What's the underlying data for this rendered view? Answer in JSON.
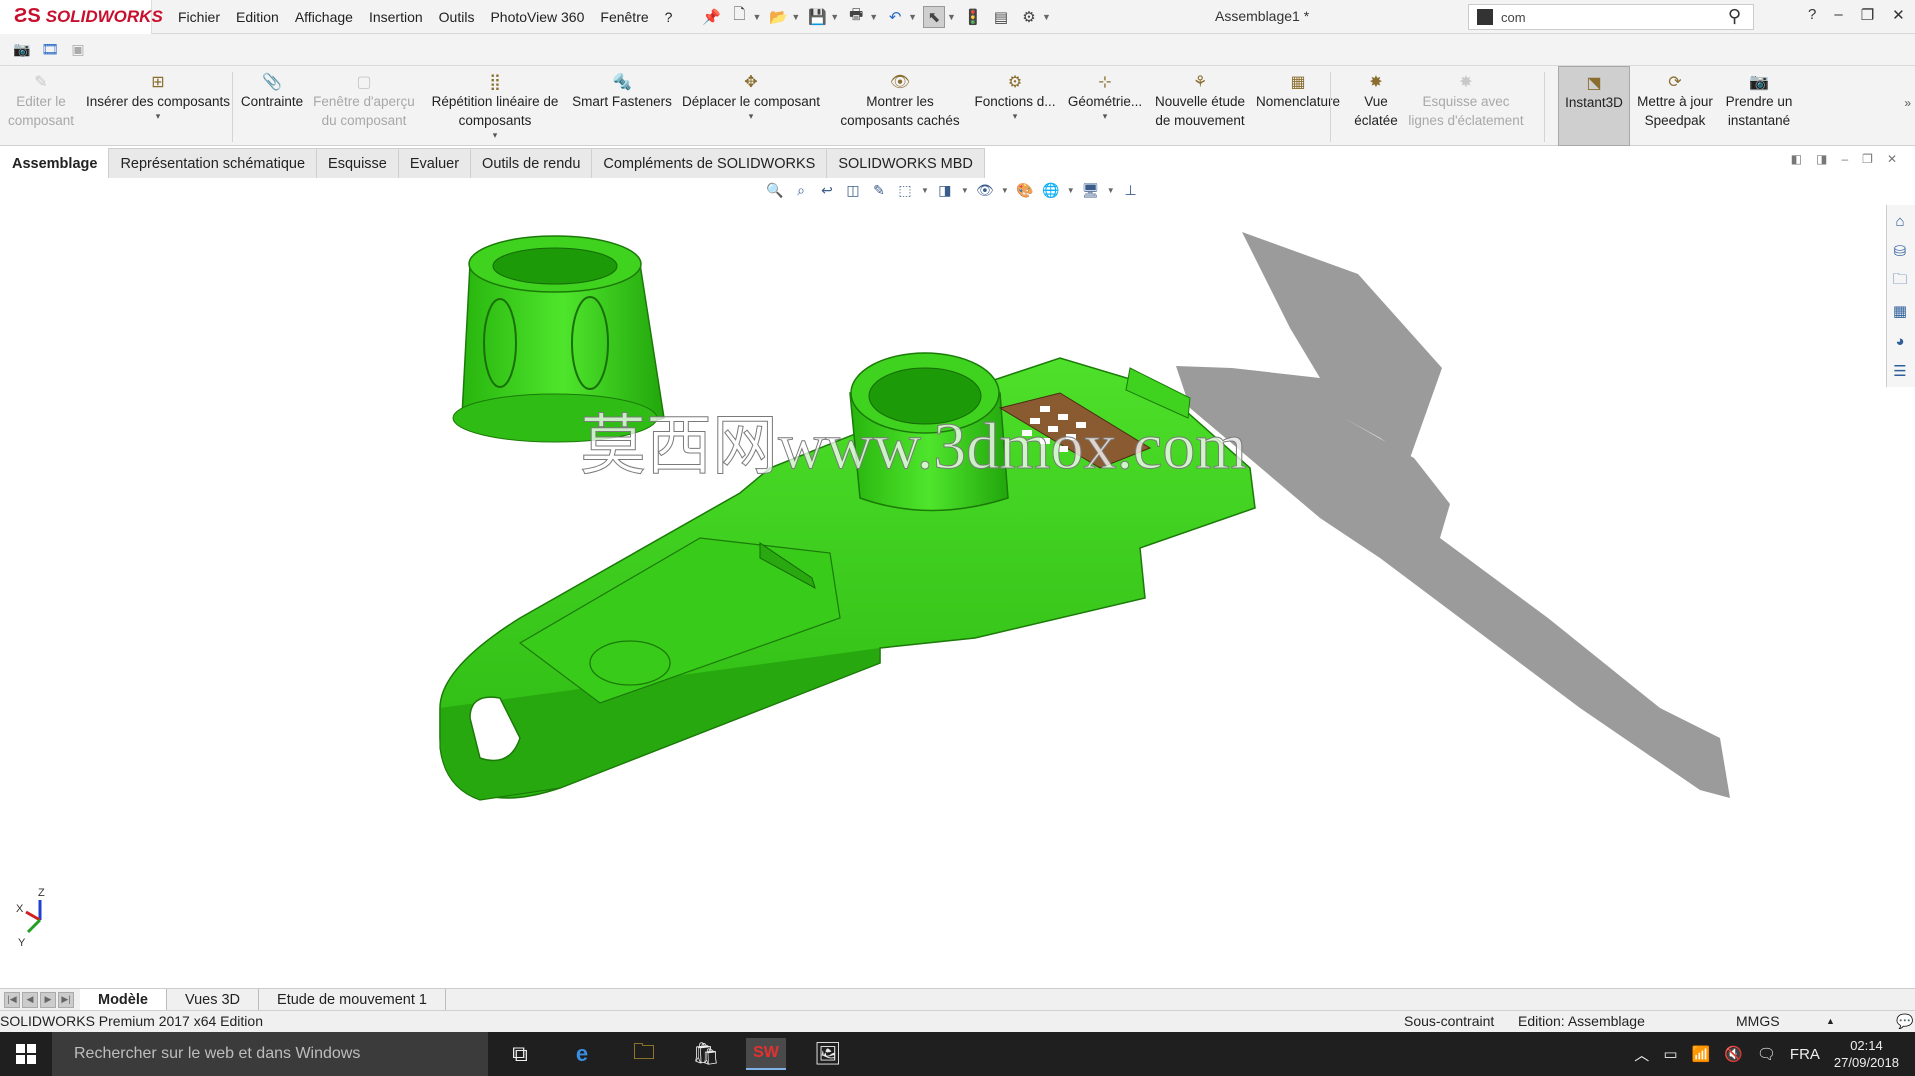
{
  "app": {
    "brand": "SOLIDWORKS",
    "document_title": "Assemblage1 *",
    "menu": [
      "Fichier",
      "Edition",
      "Affichage",
      "Insertion",
      "Outils",
      "PhotoView 360",
      "Fenêtre",
      "?"
    ],
    "search_value": "com"
  },
  "command_manager": [
    {
      "label": "Editer le composant",
      "icon": "edit-component-icon",
      "disabled": true
    },
    {
      "label": "Insérer des composants",
      "icon": "insert-components-icon",
      "dropdown": true
    },
    {
      "label": "Contrainte",
      "icon": "mate-paperclip-icon"
    },
    {
      "label": "Fenêtre d'aperçu du composant",
      "icon": "preview-window-icon",
      "disabled": true
    },
    {
      "label": "Répétition linéaire de composants",
      "icon": "linear-pattern-icon",
      "dropdown": true
    },
    {
      "label": "Smart Fasteners",
      "icon": "smart-fasteners-icon"
    },
    {
      "label": "Déplacer le composant",
      "icon": "move-component-icon",
      "dropdown": true
    },
    {
      "label": "Montrer les composants cachés",
      "icon": "show-hidden-icon"
    },
    {
      "label": "Fonctions d...",
      "icon": "assembly-features-icon",
      "dropdown": true
    },
    {
      "label": "Géométrie...",
      "icon": "reference-geometry-icon",
      "dropdown": true
    },
    {
      "label": "Nouvelle étude de mouvement",
      "icon": "motion-study-icon"
    },
    {
      "label": "Nomenclature",
      "icon": "bom-icon"
    },
    {
      "label": "Vue éclatée",
      "icon": "exploded-view-icon"
    },
    {
      "label": "Esquisse avec lignes d'éclatement",
      "icon": "explode-line-sketch-icon",
      "disabled": true
    },
    {
      "label": "Instant3D",
      "icon": "instant3d-icon",
      "active": true
    },
    {
      "label": "Mettre à jour Speedpak",
      "icon": "speedpak-icon"
    },
    {
      "label": "Prendre un instantané",
      "icon": "snapshot-icon"
    }
  ],
  "tabs": [
    "Assemblage",
    "Représentation schématique",
    "Esquisse",
    "Evaluer",
    "Outils de rendu",
    "Compléments de SOLIDWORKS",
    "SOLIDWORKS MBD"
  ],
  "active_tab": "Assemblage",
  "viewport": {
    "watermark": "莫西网www.3dmox.com",
    "model_color": "#3fd21e",
    "shadow_color": "#8a8a8a",
    "triad_labels": [
      "Z",
      "X",
      "Y"
    ]
  },
  "bottom_tabs": [
    "Modèle",
    "Vues 3D",
    "Etude de mouvement 1"
  ],
  "active_bottom_tab": "Modèle",
  "status": {
    "edition_name": "SOLIDWORKS Premium 2017 x64 Edition",
    "constraint": "Sous-contraint",
    "editing": "Edition: Assemblage",
    "units": "MMGS"
  },
  "taskbar": {
    "search_placeholder": "Rechercher sur le web et dans Windows",
    "language": "FRA",
    "time": "02:14",
    "date": "27/09/2018"
  }
}
